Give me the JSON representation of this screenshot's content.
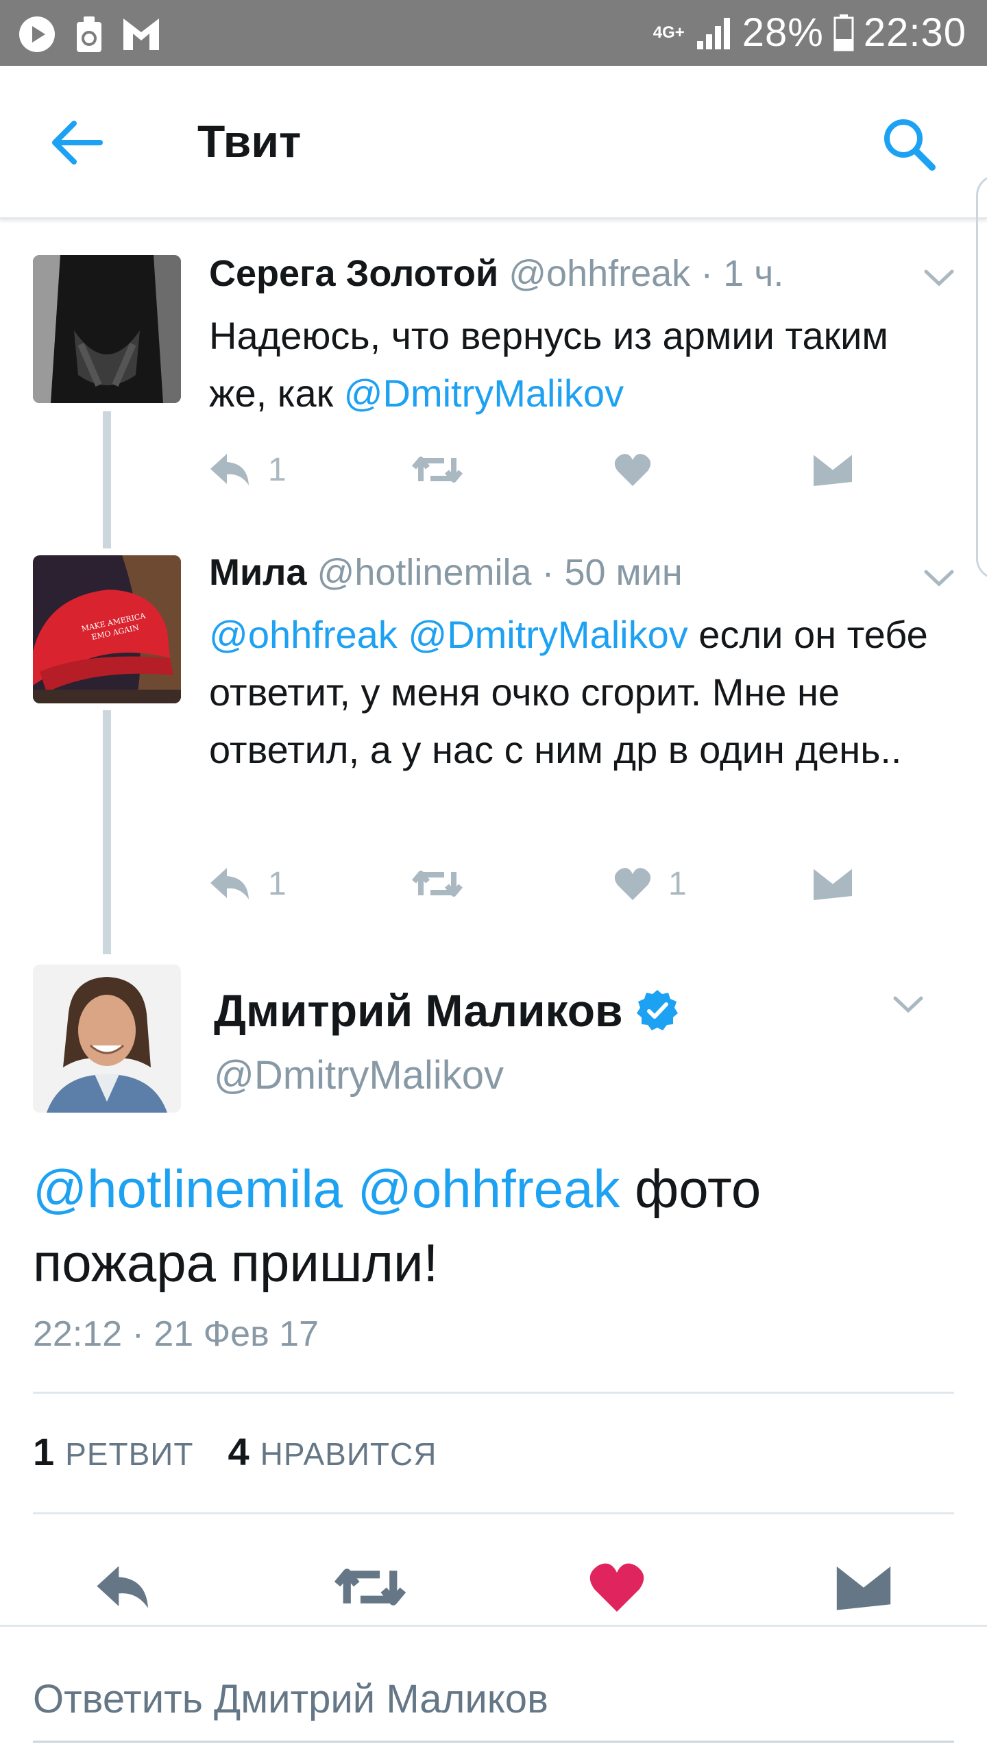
{
  "status_bar": {
    "network": "4G+",
    "battery": "28%",
    "time": "22:30"
  },
  "header": {
    "title": "Твит",
    "back_icon": "arrow-left-icon",
    "search_icon": "search-icon"
  },
  "colors": {
    "accent": "#1da1f2",
    "like_active": "#e0245e",
    "muted": "#8899a6",
    "action_icon": "#aab8c2"
  },
  "thread": [
    {
      "name": "Серега Золотой",
      "handle": "@ohhfreak",
      "time": "· 1 ч.",
      "text_plain": "Надеюсь, что вернусь из армии таким же, как ",
      "mention_1": "@DmitryMalikov",
      "reply_count": "1",
      "like_count": ""
    },
    {
      "name": "Мила",
      "handle": "@hotlinemila",
      "time": "· 50 мин",
      "mention_1": "@ohhfreak",
      "mention_2": "@DmitryMalikov",
      "text_plain": " если он тебе ответит, у меня очко сгорит. Мне не ответил, а у нас с ним др в один день..",
      "reply_count": "1",
      "like_count": "1",
      "avatar_caption": "MAKE AMERICA EMO AGAIN"
    }
  ],
  "main_tweet": {
    "name": "Дмитрий Маликов",
    "handle": "@DmitryMalikov",
    "verified_icon": "verified-badge-icon",
    "mention_1": "@hotlinemila",
    "mention_2": "@ohhfreak",
    "text_plain": " фото пожара пришли!",
    "timestamp": "22:12 · 21 Фев 17",
    "retweet_count": "1",
    "retweet_label": "РЕТВИТ",
    "like_count": "4",
    "like_label": "НРАВИТСЯ",
    "liked": true
  },
  "reply_bar": {
    "placeholder": "Ответить Дмитрий Маликов"
  }
}
